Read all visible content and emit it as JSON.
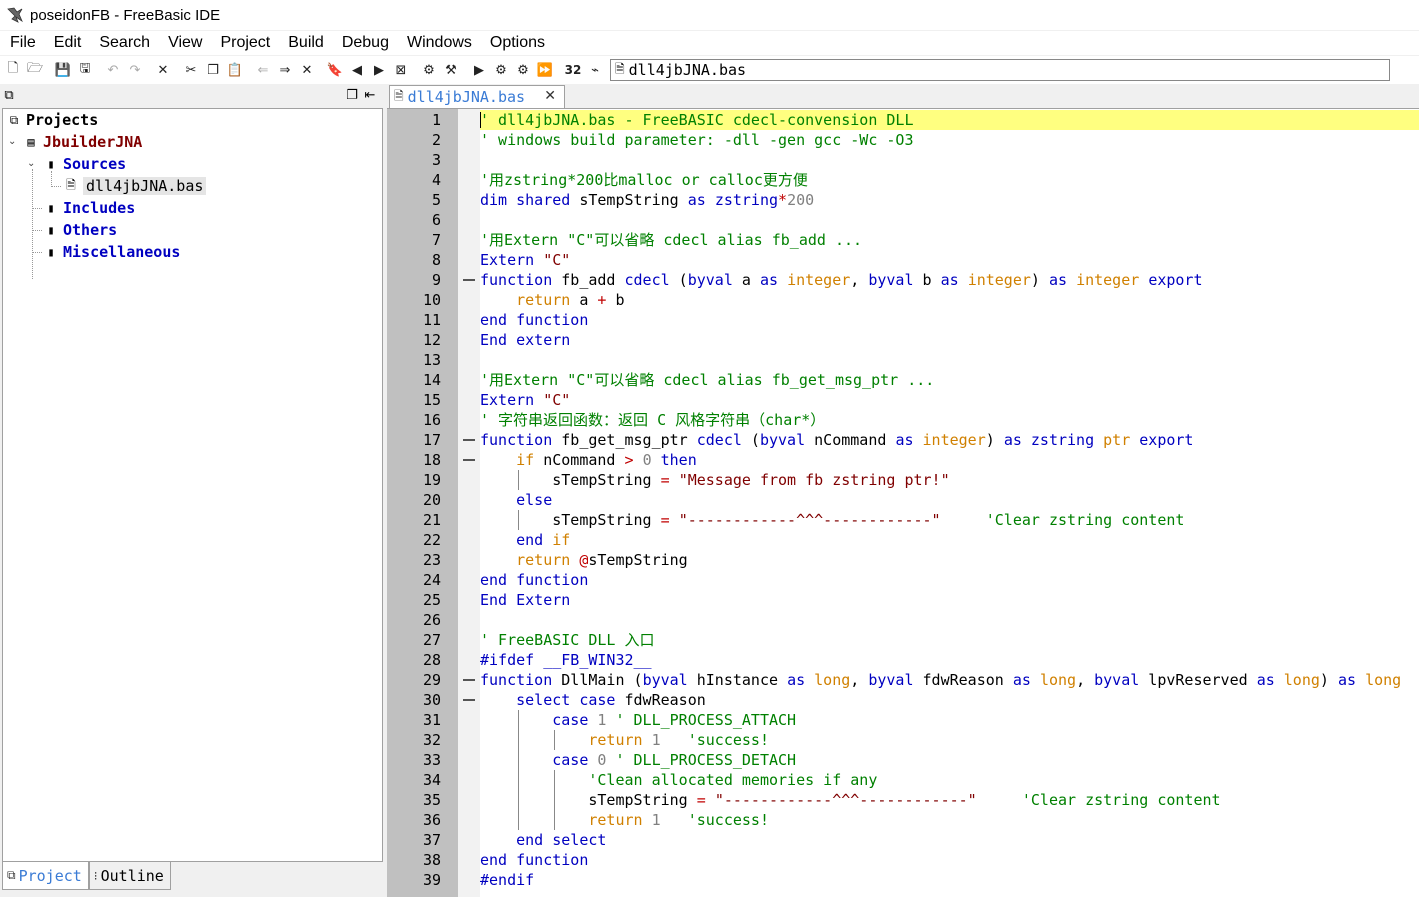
{
  "window": {
    "title": "poseidonFB - FreeBasic IDE"
  },
  "menu": [
    "File",
    "Edit",
    "Search",
    "View",
    "Project",
    "Build",
    "Debug",
    "Windows",
    "Options"
  ],
  "toolbar": {
    "current_file": "dll4jbJNA.bas",
    "buttons": [
      {
        "name": "new-file-icon",
        "glyph": "🗋"
      },
      {
        "name": "open-file-icon",
        "glyph": "🗁"
      },
      {
        "name": "save-icon",
        "glyph": "💾"
      },
      {
        "name": "save-all-icon",
        "glyph": "🖫"
      },
      {
        "name": "undo-icon",
        "glyph": "↶",
        "disabled": true
      },
      {
        "name": "redo-icon",
        "glyph": "↷",
        "disabled": true
      },
      {
        "name": "clear-icon",
        "glyph": "✕"
      },
      {
        "name": "cut-icon",
        "glyph": "✂"
      },
      {
        "name": "copy-icon",
        "glyph": "❐"
      },
      {
        "name": "paste-icon",
        "glyph": "📋"
      },
      {
        "name": "back-icon",
        "glyph": "⇐",
        "disabled": true
      },
      {
        "name": "forward-icon",
        "glyph": "⇒"
      },
      {
        "name": "close-icon",
        "glyph": "✕"
      },
      {
        "name": "bookmark-icon",
        "glyph": "🔖"
      },
      {
        "name": "prev-bookmark-icon",
        "glyph": "◀"
      },
      {
        "name": "next-bookmark-icon",
        "glyph": "▶"
      },
      {
        "name": "clear-bookmarks-icon",
        "glyph": "⊠"
      },
      {
        "name": "compile-icon",
        "glyph": "⚙"
      },
      {
        "name": "build-icon",
        "glyph": "⚒"
      },
      {
        "name": "run-icon",
        "glyph": "▶"
      },
      {
        "name": "build-settings-icon",
        "glyph": "⚙"
      },
      {
        "name": "rebuild-icon",
        "glyph": "⚙"
      },
      {
        "name": "quick-run-icon",
        "glyph": "⏩"
      },
      {
        "name": "bit32-icon",
        "glyph": "32"
      },
      {
        "name": "terminal-icon",
        "glyph": "⌁"
      }
    ]
  },
  "sidebar": {
    "tree": {
      "projects_label": "Projects",
      "project": "JbuilderJNA",
      "folders": {
        "sources": "Sources",
        "source_file": "dll4jbJNA.bas",
        "includes": "Includes",
        "others": "Others",
        "misc": "Miscellaneous"
      }
    },
    "tabs": [
      "Project",
      "Outline"
    ]
  },
  "editor": {
    "tab_label": "dll4jbJNA.bas",
    "colors": {
      "comment": "#008000",
      "keyword": "#0000c0",
      "type": "#d08000",
      "number": "#808080",
      "string": "#800000",
      "highlight": "#ffff80"
    },
    "lines": [
      [
        [
          "c",
          "' dll4jbJNA.bas - FreeBASIC cdecl-convension DLL"
        ]
      ],
      [
        [
          "c",
          "' windows build parameter: -dll -gen gcc -Wc -O3"
        ]
      ],
      [],
      [
        [
          "c",
          "'用zstring*200比malloc or calloc更方便"
        ]
      ],
      [
        [
          "k",
          "dim"
        ],
        [
          "t",
          " "
        ],
        [
          "k",
          "shared"
        ],
        [
          "t",
          " sTempString "
        ],
        [
          "k",
          "as"
        ],
        [
          "t",
          " "
        ],
        [
          "k",
          "zstring"
        ],
        [
          "o",
          "*"
        ],
        [
          "n",
          "200"
        ]
      ],
      [],
      [
        [
          "c",
          "'用Extern \"C\"可以省略 cdecl alias fb_add ..."
        ]
      ],
      [
        [
          "k",
          "Extern"
        ],
        [
          "t",
          " "
        ],
        [
          "s",
          "\"C\""
        ]
      ],
      [
        [
          "k",
          "function"
        ],
        [
          "t",
          " fb_add "
        ],
        [
          "k",
          "cdecl"
        ],
        [
          "t",
          " ("
        ],
        [
          "k",
          "byval"
        ],
        [
          "t",
          " a "
        ],
        [
          "k",
          "as"
        ],
        [
          "t",
          " "
        ],
        [
          "y",
          "integer"
        ],
        [
          "t",
          ", "
        ],
        [
          "k",
          "byval"
        ],
        [
          "t",
          " b "
        ],
        [
          "k",
          "as"
        ],
        [
          "t",
          " "
        ],
        [
          "y",
          "integer"
        ],
        [
          "t",
          ") "
        ],
        [
          "k",
          "as"
        ],
        [
          "t",
          " "
        ],
        [
          "y",
          "integer"
        ],
        [
          "t",
          " "
        ],
        [
          "k",
          "export"
        ]
      ],
      [
        [
          "t",
          "    "
        ],
        [
          "y",
          "return"
        ],
        [
          "t",
          " a "
        ],
        [
          "o",
          "+"
        ],
        [
          "t",
          " b"
        ]
      ],
      [
        [
          "k",
          "end"
        ],
        [
          "t",
          " "
        ],
        [
          "k",
          "function"
        ]
      ],
      [
        [
          "k",
          "End"
        ],
        [
          "t",
          " "
        ],
        [
          "k",
          "extern"
        ]
      ],
      [],
      [
        [
          "c",
          "'用Extern \"C\"可以省略 cdecl alias fb_get_msg_ptr ..."
        ]
      ],
      [
        [
          "k",
          "Extern"
        ],
        [
          "t",
          " "
        ],
        [
          "s",
          "\"C\""
        ]
      ],
      [
        [
          "c",
          "' 字符串返回函数：返回 C 风格字符串（char*）"
        ]
      ],
      [
        [
          "k",
          "function"
        ],
        [
          "t",
          " fb_get_msg_ptr "
        ],
        [
          "k",
          "cdecl"
        ],
        [
          "t",
          " ("
        ],
        [
          "k",
          "byval"
        ],
        [
          "t",
          " nCommand "
        ],
        [
          "k",
          "as"
        ],
        [
          "t",
          " "
        ],
        [
          "y",
          "integer"
        ],
        [
          "t",
          ") "
        ],
        [
          "k",
          "as"
        ],
        [
          "t",
          " "
        ],
        [
          "k",
          "zstring"
        ],
        [
          "t",
          " "
        ],
        [
          "y",
          "ptr"
        ],
        [
          "t",
          " "
        ],
        [
          "k",
          "export"
        ]
      ],
      [
        [
          "t",
          "    "
        ],
        [
          "y",
          "if"
        ],
        [
          "t",
          " nCommand "
        ],
        [
          "o",
          ">"
        ],
        [
          "t",
          " "
        ],
        [
          "n",
          "0"
        ],
        [
          "t",
          " "
        ],
        [
          "k",
          "then"
        ]
      ],
      [
        [
          "t",
          "        sTempString "
        ],
        [
          "o",
          "="
        ],
        [
          "t",
          " "
        ],
        [
          "s",
          "\"Message from fb zstring ptr!\""
        ]
      ],
      [
        [
          "t",
          "    "
        ],
        [
          "k",
          "else"
        ]
      ],
      [
        [
          "t",
          "        sTempString "
        ],
        [
          "o",
          "="
        ],
        [
          "t",
          " "
        ],
        [
          "s",
          "\"------------^^^------------\""
        ],
        [
          "t",
          "     "
        ],
        [
          "c",
          "'Clear zstring content"
        ]
      ],
      [
        [
          "t",
          "    "
        ],
        [
          "k",
          "end"
        ],
        [
          "t",
          " "
        ],
        [
          "y",
          "if"
        ]
      ],
      [
        [
          "t",
          "    "
        ],
        [
          "y",
          "return"
        ],
        [
          "t",
          " "
        ],
        [
          "o",
          "@"
        ],
        [
          "t",
          "sTempString"
        ]
      ],
      [
        [
          "k",
          "end"
        ],
        [
          "t",
          " "
        ],
        [
          "k",
          "function"
        ]
      ],
      [
        [
          "k",
          "End"
        ],
        [
          "t",
          " "
        ],
        [
          "k",
          "Extern"
        ]
      ],
      [],
      [
        [
          "c",
          "' FreeBASIC DLL 入口"
        ]
      ],
      [
        [
          "k",
          "#ifdef"
        ],
        [
          "t",
          " "
        ],
        [
          "k",
          "__FB_WIN32__"
        ]
      ],
      [
        [
          "k",
          "function"
        ],
        [
          "t",
          " DllMain ("
        ],
        [
          "k",
          "byval"
        ],
        [
          "t",
          " hInstance "
        ],
        [
          "k",
          "as"
        ],
        [
          "t",
          " "
        ],
        [
          "y",
          "long"
        ],
        [
          "t",
          ", "
        ],
        [
          "k",
          "byval"
        ],
        [
          "t",
          " fdwReason "
        ],
        [
          "k",
          "as"
        ],
        [
          "t",
          " "
        ],
        [
          "y",
          "long"
        ],
        [
          "t",
          ", "
        ],
        [
          "k",
          "byval"
        ],
        [
          "t",
          " lpvReserved "
        ],
        [
          "k",
          "as"
        ],
        [
          "t",
          " "
        ],
        [
          "y",
          "long"
        ],
        [
          "t",
          ") "
        ],
        [
          "k",
          "as"
        ],
        [
          "t",
          " "
        ],
        [
          "y",
          "long"
        ]
      ],
      [
        [
          "t",
          "    "
        ],
        [
          "k",
          "select"
        ],
        [
          "t",
          " "
        ],
        [
          "k",
          "case"
        ],
        [
          "t",
          " fdwReason"
        ]
      ],
      [
        [
          "t",
          "        "
        ],
        [
          "k",
          "case"
        ],
        [
          "t",
          " "
        ],
        [
          "n",
          "1"
        ],
        [
          "t",
          " "
        ],
        [
          "c",
          "' DLL_PROCESS_ATTACH"
        ]
      ],
      [
        [
          "t",
          "            "
        ],
        [
          "y",
          "return"
        ],
        [
          "t",
          " "
        ],
        [
          "n",
          "1"
        ],
        [
          "t",
          "   "
        ],
        [
          "c",
          "'success!"
        ]
      ],
      [
        [
          "t",
          "        "
        ],
        [
          "k",
          "case"
        ],
        [
          "t",
          " "
        ],
        [
          "n",
          "0"
        ],
        [
          "t",
          " "
        ],
        [
          "c",
          "' DLL_PROCESS_DETACH"
        ]
      ],
      [
        [
          "t",
          "            "
        ],
        [
          "c",
          "'Clean allocated memories if any"
        ]
      ],
      [
        [
          "t",
          "            sTempString "
        ],
        [
          "o",
          "="
        ],
        [
          "t",
          " "
        ],
        [
          "s",
          "\"------------^^^------------\""
        ],
        [
          "t",
          "     "
        ],
        [
          "c",
          "'Clear zstring content"
        ]
      ],
      [
        [
          "t",
          "            "
        ],
        [
          "y",
          "return"
        ],
        [
          "t",
          " "
        ],
        [
          "n",
          "1"
        ],
        [
          "t",
          "   "
        ],
        [
          "c",
          "'success!"
        ]
      ],
      [
        [
          "t",
          "    "
        ],
        [
          "k",
          "end"
        ],
        [
          "t",
          " "
        ],
        [
          "k",
          "select"
        ]
      ],
      [
        [
          "k",
          "end"
        ],
        [
          "t",
          " "
        ],
        [
          "k",
          "function"
        ]
      ],
      [
        [
          "k",
          "#endif"
        ]
      ]
    ]
  }
}
